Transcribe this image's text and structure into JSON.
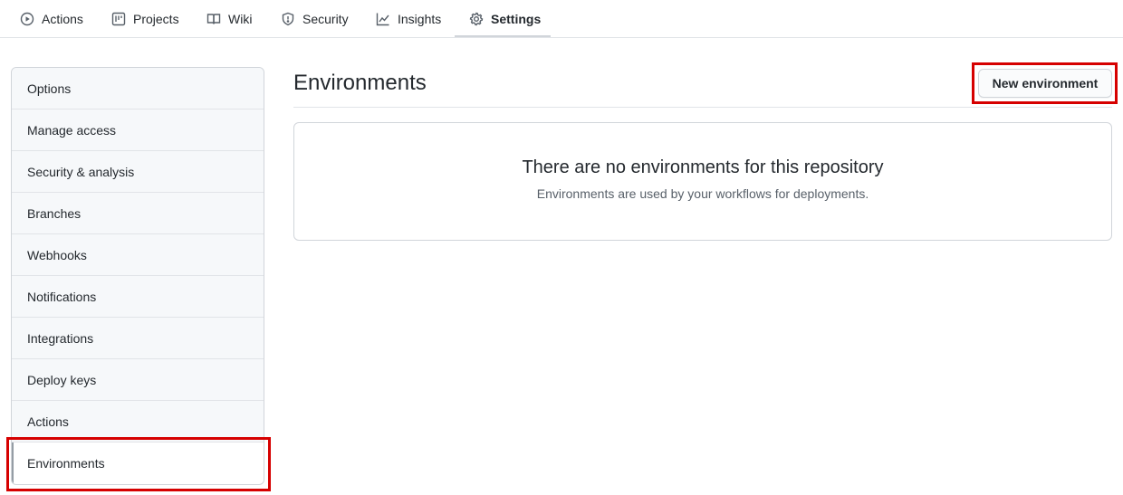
{
  "topnav": {
    "tabs": [
      {
        "label": "Actions",
        "icon": "play-icon"
      },
      {
        "label": "Projects",
        "icon": "project-icon"
      },
      {
        "label": "Wiki",
        "icon": "book-icon"
      },
      {
        "label": "Security",
        "icon": "shield-icon"
      },
      {
        "label": "Insights",
        "icon": "graph-icon"
      },
      {
        "label": "Settings",
        "icon": "gear-icon",
        "selected": true
      }
    ]
  },
  "sidebar": {
    "items": [
      {
        "label": "Options"
      },
      {
        "label": "Manage access"
      },
      {
        "label": "Security & analysis"
      },
      {
        "label": "Branches"
      },
      {
        "label": "Webhooks"
      },
      {
        "label": "Notifications"
      },
      {
        "label": "Integrations"
      },
      {
        "label": "Deploy keys"
      },
      {
        "label": "Actions"
      },
      {
        "label": "Environments",
        "selected": true
      }
    ]
  },
  "main": {
    "title": "Environments",
    "new_button": "New environment",
    "blankslate": {
      "heading": "There are no environments for this repository",
      "description": "Environments are used by your workflows for deployments."
    }
  },
  "colors": {
    "highlight": "#d60000",
    "border": "#d1d5da"
  }
}
